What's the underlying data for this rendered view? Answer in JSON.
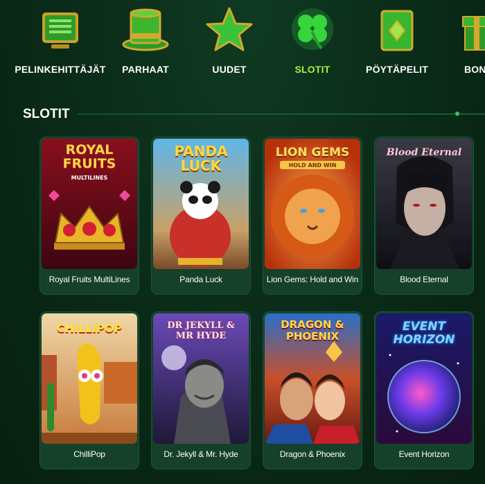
{
  "categories": [
    {
      "label": "PELINKEHITTÄJÄT",
      "icon": "provider-monitor-icon",
      "active": false
    },
    {
      "label": "PARHAAT",
      "icon": "top-hat-icon",
      "active": false
    },
    {
      "label": "UUDET",
      "icon": "star-icon",
      "active": false
    },
    {
      "label": "SLOTIT",
      "icon": "clover-icon",
      "active": true
    },
    {
      "label": "PÖYTÄPELIT",
      "icon": "card-table-icon",
      "active": false
    },
    {
      "label": "BONUS",
      "icon": "gift-icon",
      "active": false
    }
  ],
  "section": {
    "title": "SLOTIT"
  },
  "games": [
    {
      "name": "Royal Fruits MultiLines",
      "art_title": "ROYAL FRUITS",
      "art_sub": "MULTILINES"
    },
    {
      "name": "Panda Luck",
      "art_title": "PANDA LUCK",
      "art_sub": ""
    },
    {
      "name": "Lion Gems: Hold and Win",
      "art_title": "LION GEMS",
      "art_sub": "HOLD AND WIN"
    },
    {
      "name": "Blood Eternal",
      "art_title": "Blood Eternal",
      "art_sub": ""
    },
    {
      "name": "ChilliPop",
      "art_title": "CHILLIPOP",
      "art_sub": ""
    },
    {
      "name": "Dr. Jekyll & Mr. Hyde",
      "art_title": "DR JEKYLL & MR HYDE",
      "art_sub": ""
    },
    {
      "name": "Dragon & Phoenix",
      "art_title": "DRAGON & PHOENIX",
      "art_sub": ""
    },
    {
      "name": "Event Horizon",
      "art_title": "EVENT HORIZON",
      "art_sub": ""
    }
  ],
  "colors": {
    "accent": "#a8f23a",
    "background": "#0a2a18",
    "card": "#15402a"
  }
}
